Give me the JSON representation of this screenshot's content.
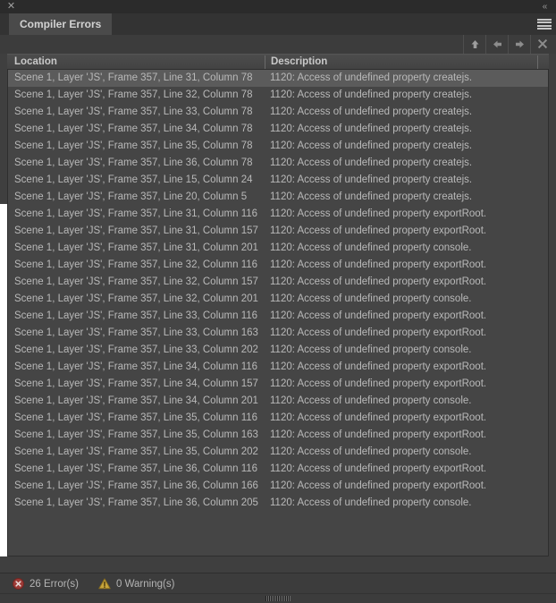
{
  "window": {
    "close_label": "✕",
    "collapse_label": "«",
    "menu_label": "panel-menu"
  },
  "tabs": [
    {
      "label": "Compiler Errors",
      "active": true
    }
  ],
  "toolbar": {
    "buttons": [
      {
        "name": "go-to-source-button",
        "icon": "arrow-up-icon",
        "label": "Go to source"
      },
      {
        "name": "previous-error-button",
        "icon": "arrow-left-icon",
        "label": "Previous error"
      },
      {
        "name": "next-error-button",
        "icon": "arrow-right-icon",
        "label": "Next error"
      },
      {
        "name": "clear-errors-button",
        "icon": "close-x-icon",
        "label": "Clear"
      }
    ]
  },
  "table": {
    "columns": [
      {
        "key": "location",
        "label": "Location"
      },
      {
        "key": "description",
        "label": "Description"
      }
    ],
    "selected_index": 0,
    "rows": [
      {
        "location": "Scene 1, Layer 'JS', Frame 357, Line 31, Column 78",
        "description": "1120: Access of undefined property createjs."
      },
      {
        "location": "Scene 1, Layer 'JS', Frame 357, Line 32, Column 78",
        "description": "1120: Access of undefined property createjs."
      },
      {
        "location": "Scene 1, Layer 'JS', Frame 357, Line 33, Column 78",
        "description": "1120: Access of undefined property createjs."
      },
      {
        "location": "Scene 1, Layer 'JS', Frame 357, Line 34, Column 78",
        "description": "1120: Access of undefined property createjs."
      },
      {
        "location": "Scene 1, Layer 'JS', Frame 357, Line 35, Column 78",
        "description": "1120: Access of undefined property createjs."
      },
      {
        "location": "Scene 1, Layer 'JS', Frame 357, Line 36, Column 78",
        "description": "1120: Access of undefined property createjs."
      },
      {
        "location": "Scene 1, Layer 'JS', Frame 357, Line 15, Column 24",
        "description": "1120: Access of undefined property createjs."
      },
      {
        "location": "Scene 1, Layer 'JS', Frame 357, Line 20, Column 5",
        "description": "1120: Access of undefined property createjs."
      },
      {
        "location": "Scene 1, Layer 'JS', Frame 357, Line 31, Column 116",
        "description": "1120: Access of undefined property exportRoot."
      },
      {
        "location": "Scene 1, Layer 'JS', Frame 357, Line 31, Column 157",
        "description": "1120: Access of undefined property exportRoot."
      },
      {
        "location": "Scene 1, Layer 'JS', Frame 357, Line 31, Column 201",
        "description": "1120: Access of undefined property console."
      },
      {
        "location": "Scene 1, Layer 'JS', Frame 357, Line 32, Column 116",
        "description": "1120: Access of undefined property exportRoot."
      },
      {
        "location": "Scene 1, Layer 'JS', Frame 357, Line 32, Column 157",
        "description": "1120: Access of undefined property exportRoot."
      },
      {
        "location": "Scene 1, Layer 'JS', Frame 357, Line 32, Column 201",
        "description": "1120: Access of undefined property console."
      },
      {
        "location": "Scene 1, Layer 'JS', Frame 357, Line 33, Column 116",
        "description": "1120: Access of undefined property exportRoot."
      },
      {
        "location": "Scene 1, Layer 'JS', Frame 357, Line 33, Column 163",
        "description": "1120: Access of undefined property exportRoot."
      },
      {
        "location": "Scene 1, Layer 'JS', Frame 357, Line 33, Column 202",
        "description": "1120: Access of undefined property console."
      },
      {
        "location": "Scene 1, Layer 'JS', Frame 357, Line 34, Column 116",
        "description": "1120: Access of undefined property exportRoot."
      },
      {
        "location": "Scene 1, Layer 'JS', Frame 357, Line 34, Column 157",
        "description": "1120: Access of undefined property exportRoot."
      },
      {
        "location": "Scene 1, Layer 'JS', Frame 357, Line 34, Column 201",
        "description": "1120: Access of undefined property console."
      },
      {
        "location": "Scene 1, Layer 'JS', Frame 357, Line 35, Column 116",
        "description": "1120: Access of undefined property exportRoot."
      },
      {
        "location": "Scene 1, Layer 'JS', Frame 357, Line 35, Column 163",
        "description": "1120: Access of undefined property exportRoot."
      },
      {
        "location": "Scene 1, Layer 'JS', Frame 357, Line 35, Column 202",
        "description": "1120: Access of undefined property console."
      },
      {
        "location": "Scene 1, Layer 'JS', Frame 357, Line 36, Column 116",
        "description": "1120: Access of undefined property exportRoot."
      },
      {
        "location": "Scene 1, Layer 'JS', Frame 357, Line 36, Column 166",
        "description": "1120: Access of undefined property exportRoot."
      },
      {
        "location": "Scene 1, Layer 'JS', Frame 357, Line 36, Column 205",
        "description": "1120: Access of undefined property console."
      }
    ]
  },
  "status": {
    "errors_text": "26 Error(s)",
    "warnings_text": "0 Warning(s)"
  },
  "colors": {
    "panel_bg": "#3f3f3f",
    "list_bg": "#454545",
    "row_selected": "#5b5b5b",
    "text": "#b9b9b9",
    "header_text": "#c9c9c9",
    "tab_active_bg": "#4a4a4a",
    "error_red": "#9e3a36",
    "warning_amber": "#c8a53c"
  }
}
